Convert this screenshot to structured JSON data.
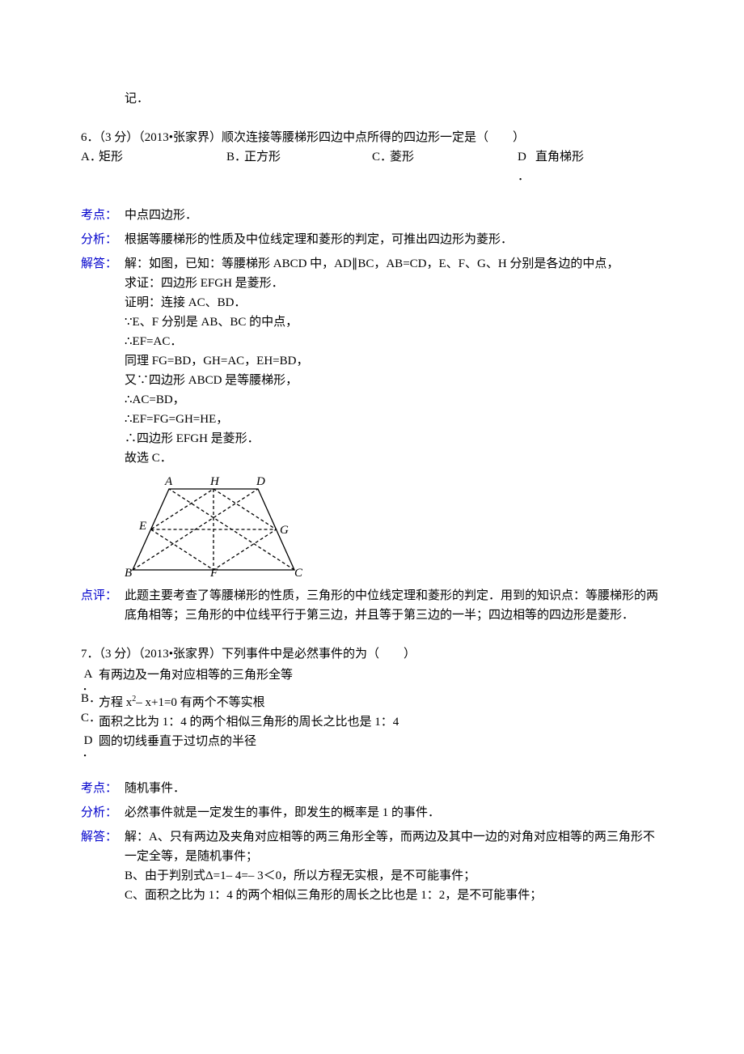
{
  "tail_line": "记．",
  "q6": {
    "stem": "6．（3 分）（2013•张家界）顺次连接等腰梯形四边中点所得的四边形一定是（　　）",
    "A": "矩形",
    "B": "正方形",
    "C": "菱形",
    "D": "直角梯形",
    "kd_label": "考点：",
    "kd": "中点四边形．",
    "fx_label": "分析：",
    "fx": "根据等腰梯形的性质及中位线定理和菱形的判定，可推出四边形为菱形．",
    "jd_label": "解答：",
    "jd_lines": [
      "解：如图，已知：等腰梯形 ABCD 中，AD∥BC，AB=CD，E、F、G、H 分别是各边的中点，",
      "求证：四边形 EFGH 是菱形．",
      "证明：连接 AC、BD．",
      "∵E、F 分别是 AB、BC 的中点，",
      "∴EF=AC．",
      "同理 FG=BD，GH=AC，EH=BD，",
      "又∵四边形 ABCD 是等腰梯形，",
      "∴AC=BD，",
      "∴EF=FG=GH=HE，",
      "∴四边形 EFGH 是菱形．",
      "故选 C．"
    ],
    "dp_label": "点评：",
    "dp": "此题主要考查了等腰梯形的性质，三角形的中位线定理和菱形的判定．用到的知识点：等腰梯形的两底角相等；三角形的中位线平行于第三边，并且等于第三边的一半；四边相等的四边形是菱形．",
    "fig_labels": {
      "A": "A",
      "B": "B",
      "C": "C",
      "D": "D",
      "E": "E",
      "F": "F",
      "G": "G",
      "H": "H"
    }
  },
  "q7": {
    "stem": "7．（3 分）（2013•张家界）下列事件中是必然事件的为（　　）",
    "A": "有两边及一角对应相等的三角形全等",
    "B_pre": "方程 x",
    "B_sup": "2",
    "B_post": "– x+1=0 有两个不等实根",
    "C": "面积之比为 1：4 的两个相似三角形的周长之比也是 1：4",
    "D": "圆的切线垂直于过切点的半径",
    "kd_label": "考点：",
    "kd": "随机事件．",
    "fx_label": "分析：",
    "fx": "必然事件就是一定发生的事件，即发生的概率是 1 的事件．",
    "jd_label": "解答：",
    "jd_lines": [
      "解：A、只有两边及夹角对应相等的两三角形全等，而两边及其中一边的对角对应相等的两三角形不一定全等，是随机事件；",
      "B、由于判别式Δ=1– 4=– 3＜0，所以方程无实根，是不可能事件；",
      "C、面积之比为 1：4 的两个相似三角形的周长之比也是 1：2，是不可能事件；"
    ]
  }
}
